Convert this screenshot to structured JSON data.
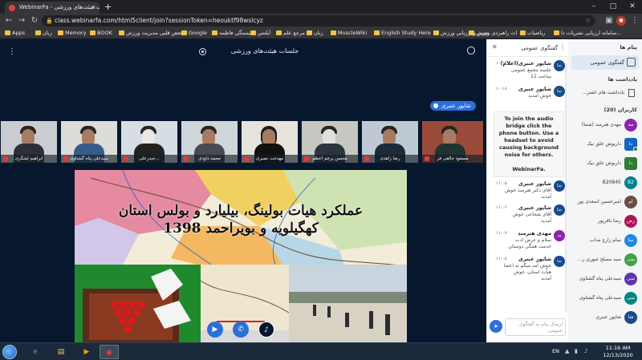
{
  "browser": {
    "tab_title": "WebinarFa - جلسات هیئت‌های ورزشی",
    "tab_close": "×",
    "new_tab": "+",
    "url": "class.webinarfa.com/html5client/join?sessionToken=heouktf98wslcyz",
    "bookmarks": [
      "Apps",
      "زبان",
      "Memory",
      "BOOK",
      "تعض قلبی مدیریت ورزش",
      "Google",
      "همبستگی فاطمه",
      "آیلتس",
      "مرجع علم",
      "زبان",
      "MuscleWiki",
      "English Study Here",
      "تعیین و ارزیابی ورزش",
      "مطالعات راهبردی ورزش",
      "ریاضیات",
      "سامانه ارزیابی نشریات دا..."
    ]
  },
  "meeting": {
    "title": "جلسات هیئت‌های ورزشی",
    "presenter": "شاپور عنبری",
    "thumbnails": [
      {
        "name": "ابراهیم لشگری"
      },
      {
        "name": "سیدعلی پناه گشتاوی"
      },
      {
        "name": "حیدرعلی..."
      },
      {
        "name": "محمد داودی"
      },
      {
        "name": "مهدخت نصیری"
      },
      {
        "name": "محسن پرچم اعظم"
      },
      {
        "name": "رضا زاهدی"
      },
      {
        "name": "مسعود خالقی فر"
      }
    ],
    "slide": {
      "title_line1": "عملکرد هیات بولینگ، بیلیارد و بولس استان",
      "title_line2": "کهگیلویه و بویراحمد 1398"
    }
  },
  "chat": {
    "title": "گفتگوی عمومی",
    "messages": [
      {
        "avatar": "شا",
        "author": "شاپور عنبری(اعلام)",
        "time": "۱۰:۱۳",
        "text": "جلسه مجمع عمومی ساعت 11"
      },
      {
        "avatar": "شا",
        "author": "شاپور عنبری",
        "time": "۱۰:۱۸",
        "text": "خوش آمدید"
      }
    ],
    "system": "To join the audio bridge click the phone button. Use a headset to avoid causing background noise for others.",
    "system_brand": "WebinarFa.",
    "messages2": [
      {
        "avatar": "شا",
        "author": "شاپور عنبری",
        "time": "۱۱:۰۵",
        "text": "آقای دکتر هنرمند خوش آمدید"
      },
      {
        "avatar": "شا",
        "author": "شاپور عنبری",
        "time": "۱۱:۰۶",
        "text": "آقای شجاعی خوش آمدید"
      },
      {
        "avatar": "مه",
        "author": "مهدی هنرمند",
        "time": "۱۱:۰۷",
        "text": "سلام و عرض ادب خدمت همگی دوستان"
      },
      {
        "avatar": "شا",
        "author": "شاپور عنبری",
        "time": "۱۱:۰۸",
        "text": "خوش آمد میگم به اعضا هیأت استان، خوش آمدید"
      }
    ],
    "input_placeholder": "ارسال پیام به گفتگوی عمومی"
  },
  "users_panel": {
    "messages_header": "پیام ها",
    "public_chat": "گفتگوی عمومی",
    "notes_header": "یادداشت ها",
    "notes_item": "یادداشت های اشتر...",
    "users_header": "کاربران (20)",
    "users": [
      {
        "avatar": "مه",
        "name": "مهدی هنرمند (شما)",
        "color": "#8e24aa"
      },
      {
        "avatar": "دا",
        "name": "داریوش خلق نیک",
        "color": "#1565c0"
      },
      {
        "avatar": "دا",
        "name": "داریوش خلق نیک",
        "color": "#2e7d32"
      },
      {
        "avatar": "B2",
        "name": "B20845",
        "color": "#00838f"
      },
      {
        "avatar": "ام",
        "name": "امیرحسین اسعدی پور",
        "color": "#6d4c41"
      },
      {
        "avatar": "رض",
        "name": "رضا باقرپور",
        "color": "#ad1457"
      },
      {
        "avatar": "سا",
        "name": "سام زارع مداب",
        "color": "#1e88e5"
      },
      {
        "avatar": "سی",
        "name": "سید مصلح غیوری ز...",
        "color": "#43a047"
      },
      {
        "avatar": "سی",
        "name": "سیدعلی پناه گشتاوی",
        "color": "#5e35b1"
      },
      {
        "avatar": "سی",
        "name": "سیدعلی پناه گشتاوی",
        "color": "#00897b"
      },
      {
        "avatar": "شا",
        "name": "شاپور عنبری",
        "color": "#1a4a8a"
      }
    ]
  },
  "taskbar": {
    "lang": "EN",
    "time": "11:16 AM",
    "date": "12/13/2020"
  }
}
